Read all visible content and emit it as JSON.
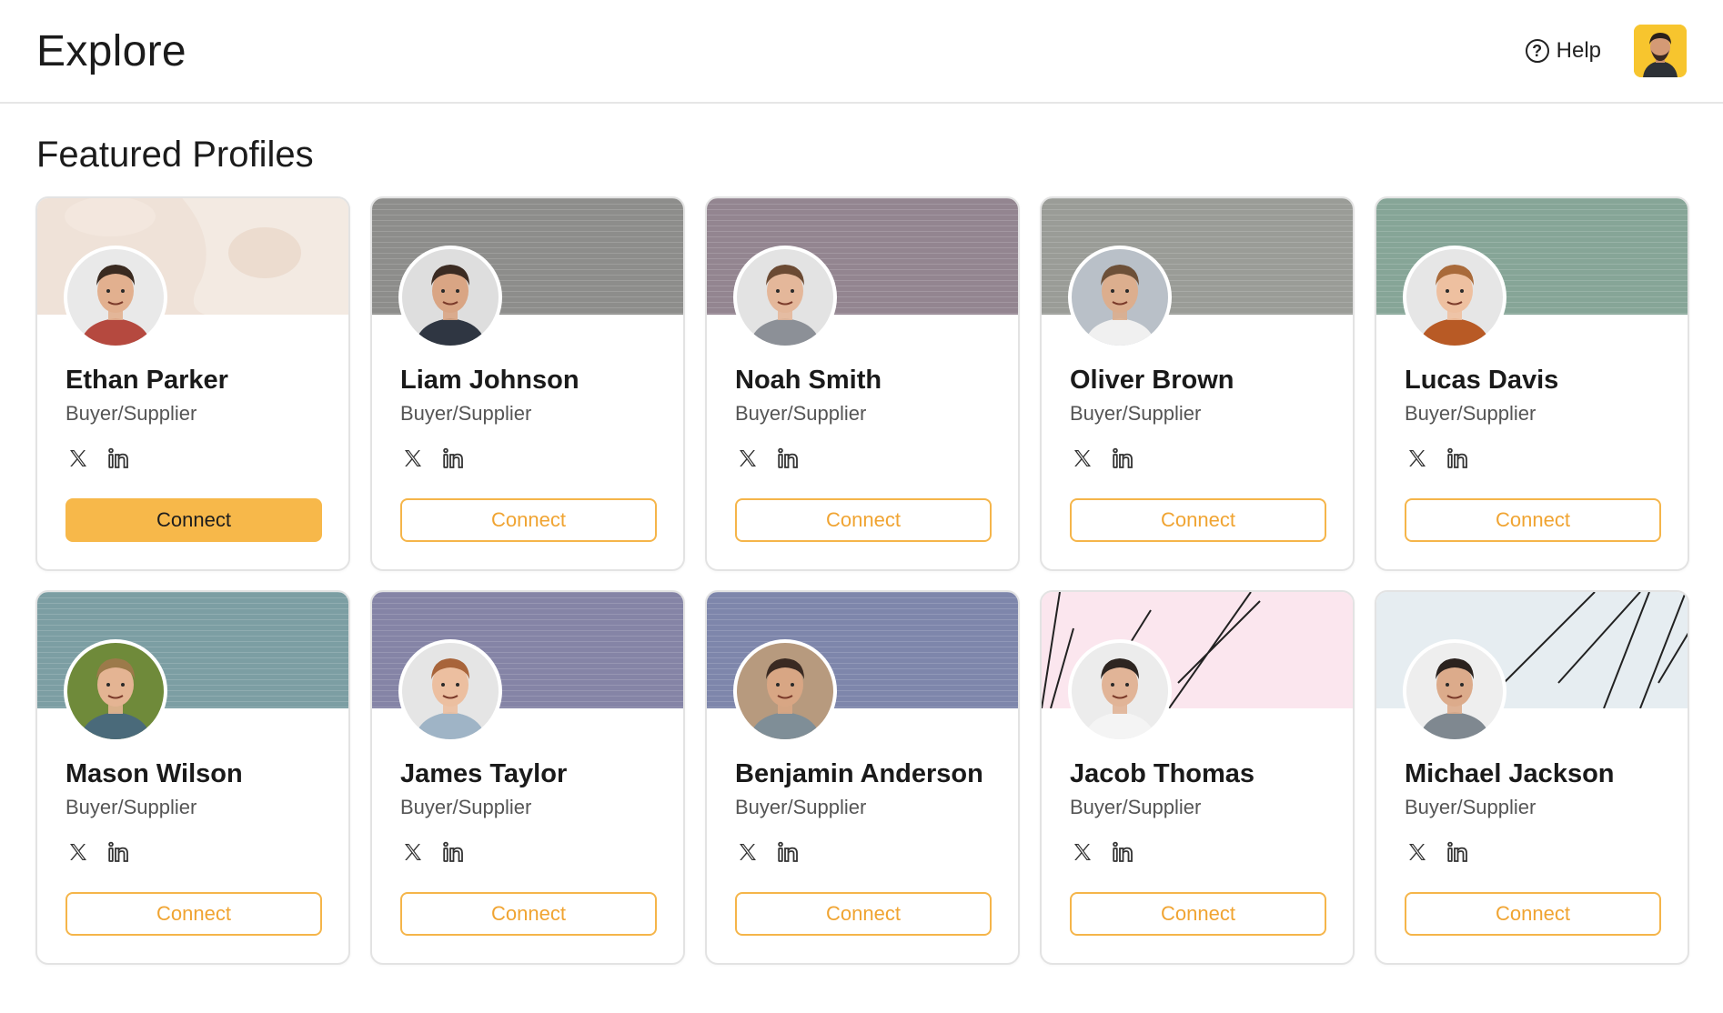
{
  "header": {
    "title": "Explore",
    "help_label": "Help",
    "help_icon": "question-circle-icon"
  },
  "section": {
    "title": "Featured Profiles"
  },
  "profiles": [
    {
      "name": "Ethan Parker",
      "role": "Buyer/Supplier",
      "connect": "Connect",
      "banner": "#efe2d8",
      "skin": "#e2b08f",
      "hair": "#3a2a20",
      "shirt": "#b5493f",
      "bg": "#e9e9e9"
    },
    {
      "name": "Liam Johnson",
      "role": "Buyer/Supplier",
      "connect": "Connect",
      "banner": "#8d8d8b",
      "skin": "#d9a584",
      "hair": "#3b2b22",
      "shirt": "#2f3642",
      "bg": "#dedede"
    },
    {
      "name": "Noah Smith",
      "role": "Buyer/Supplier",
      "connect": "Connect",
      "banner": "#938590",
      "skin": "#e4b79a",
      "hair": "#6b4a33",
      "shirt": "#8c9097",
      "bg": "#e3e3e3"
    },
    {
      "name": "Oliver Brown",
      "role": "Buyer/Supplier",
      "connect": "Connect",
      "banner": "#9a9c97",
      "skin": "#dcae8e",
      "hair": "#6d5038",
      "shirt": "#f0f0f0",
      "bg": "#b9c0c8"
    },
    {
      "name": "Lucas Davis",
      "role": "Buyer/Supplier",
      "connect": "Connect",
      "banner": "#86a597",
      "skin": "#eec0a0",
      "hair": "#a96a3a",
      "shirt": "#b85a25",
      "bg": "#e6e6e6"
    },
    {
      "name": "Mason Wilson",
      "role": "Buyer/Supplier",
      "connect": "Connect",
      "banner": "#7c9ea3",
      "skin": "#e4b493",
      "hair": "#9c7a4a",
      "shirt": "#4a6a7a",
      "bg": "#6f8a3a"
    },
    {
      "name": "James Taylor",
      "role": "Buyer/Supplier",
      "connect": "Connect",
      "banner": "#8584a6",
      "skin": "#ecbfa0",
      "hair": "#a8643a",
      "shirt": "#9fb4c6",
      "bg": "#e5e5e5"
    },
    {
      "name": "Benjamin Anderson",
      "role": "Buyer/Supplier",
      "connect": "Connect",
      "banner": "#7e86ab",
      "skin": "#d8a684",
      "hair": "#3a2a22",
      "shirt": "#7f8e97",
      "bg": "#b79a7e"
    },
    {
      "name": "Jacob Thomas",
      "role": "Buyer/Supplier",
      "connect": "Connect",
      "banner": "#fbe6ee",
      "skin": "#e1b497",
      "hair": "#2d2521",
      "shirt": "#f4f4f4",
      "bg": "#ececec"
    },
    {
      "name": "Michael Jackson",
      "role": "Buyer/Supplier",
      "connect": "Connect",
      "banner": "#e6edf1",
      "skin": "#dcab8b",
      "hair": "#2b221e",
      "shirt": "#7f8890",
      "bg": "#eeeeee"
    }
  ],
  "icons": {
    "twitter": "x-logo-icon",
    "linkedin": "linkedin-icon"
  },
  "colors": {
    "accent": "#f7b84a",
    "accent_text": "#f0a432"
  }
}
